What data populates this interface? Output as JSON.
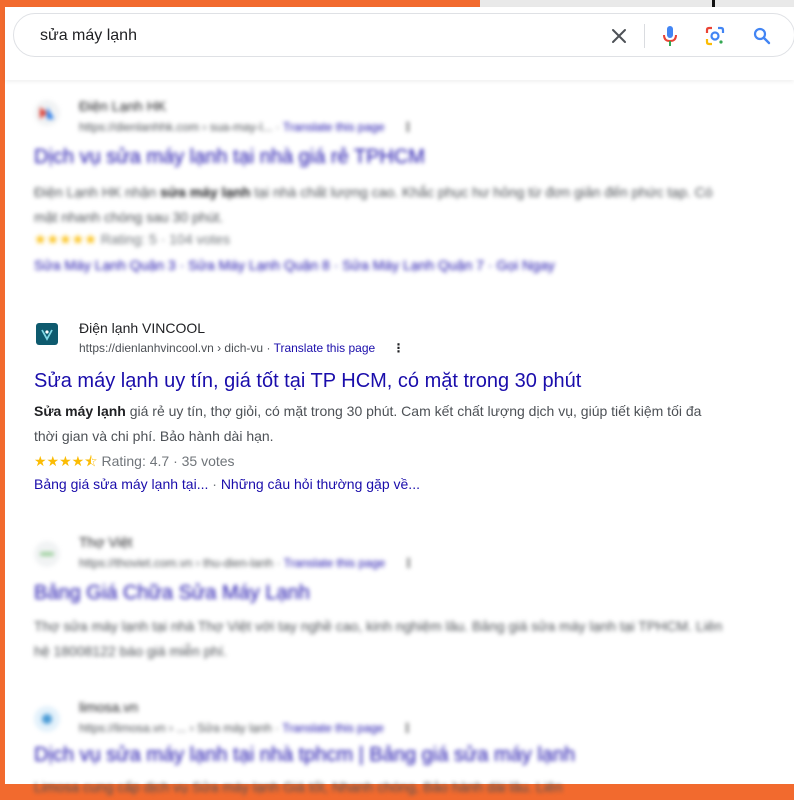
{
  "search": {
    "query": "sửa máy lạnh"
  },
  "results": [
    {
      "site_name": "Điện Lạnh HK",
      "url": "https://dienlanhhk.com › sua-may-l...",
      "translate": "Translate this page",
      "title": "Dịch vụ sửa máy lạnh tại nhà giá rẻ TPHCM",
      "snippet_parts": [
        "Điện Lạnh HK nhận ",
        "sửa máy lạnh",
        " tại nhà chất lượng cao. Khắc phục hư hỏng từ đơn giản đến phức tạp. Có mặt nhanh chóng sau 30 phút."
      ],
      "rating": "Rating: 5 · 104 votes",
      "sitelinks": "Sửa Máy Lạnh Quận 3 · Sửa Máy Lạnh Quận 8 · Sửa Máy Lạnh Quận 7 · Gọi Ngay"
    },
    {
      "site_name": "Điện lạnh VINCOOL",
      "url": "https://dienlanhvincool.vn › dich-vu",
      "translate": "Translate this page",
      "title": "Sửa máy lạnh uy tín, giá tốt tại TP HCM, có mặt trong 30 phút",
      "snippet_bold": "Sửa máy lạnh",
      "snippet_rest": " giá rẻ uy tín, thợ giỏi, có mặt trong 30 phút. Cam kết chất lượng dịch vụ, giúp tiết kiệm tối đa thời gian và chi phí. Bảo hành dài hạn.",
      "rating": "Rating: 4.7 · 35 votes",
      "sitelink_1": "Bảng giá sửa máy lạnh tại...",
      "sitelink_sep": " · ",
      "sitelink_2": "Những câu hỏi thường gặp về..."
    },
    {
      "site_name": "Thợ Việt",
      "url": "https://thoviet.com.vn › thu-dien-lanh",
      "translate": "Translate this page",
      "title": "Bảng Giá Chữa Sửa Máy Lạnh",
      "snippet": "Thợ sửa máy lạnh tại nhà Thợ Việt với tay nghề cao, kinh nghiệm lâu. Bảng giá sửa máy lạnh tại TPHCM. Liên hệ 18008122 báo giá miễn phí."
    },
    {
      "site_name": "limosa.vn",
      "url": "https://limosa.vn › ... › Sửa máy lạnh",
      "translate": "Translate this page",
      "title": "Dịch vụ sửa máy lạnh tại nhà tphcm | Bảng giá sửa máy lạnh",
      "snippet": "Limosa cung cấp dịch vụ Sửa máy lạnh Giá tốt, Nhanh chóng, Bảo hành dài lâu. Liên"
    }
  ],
  "colors": {
    "accent_orange": "#f26a2e",
    "link_blue": "#1a0dab",
    "star_yellow": "#fbbc04"
  }
}
